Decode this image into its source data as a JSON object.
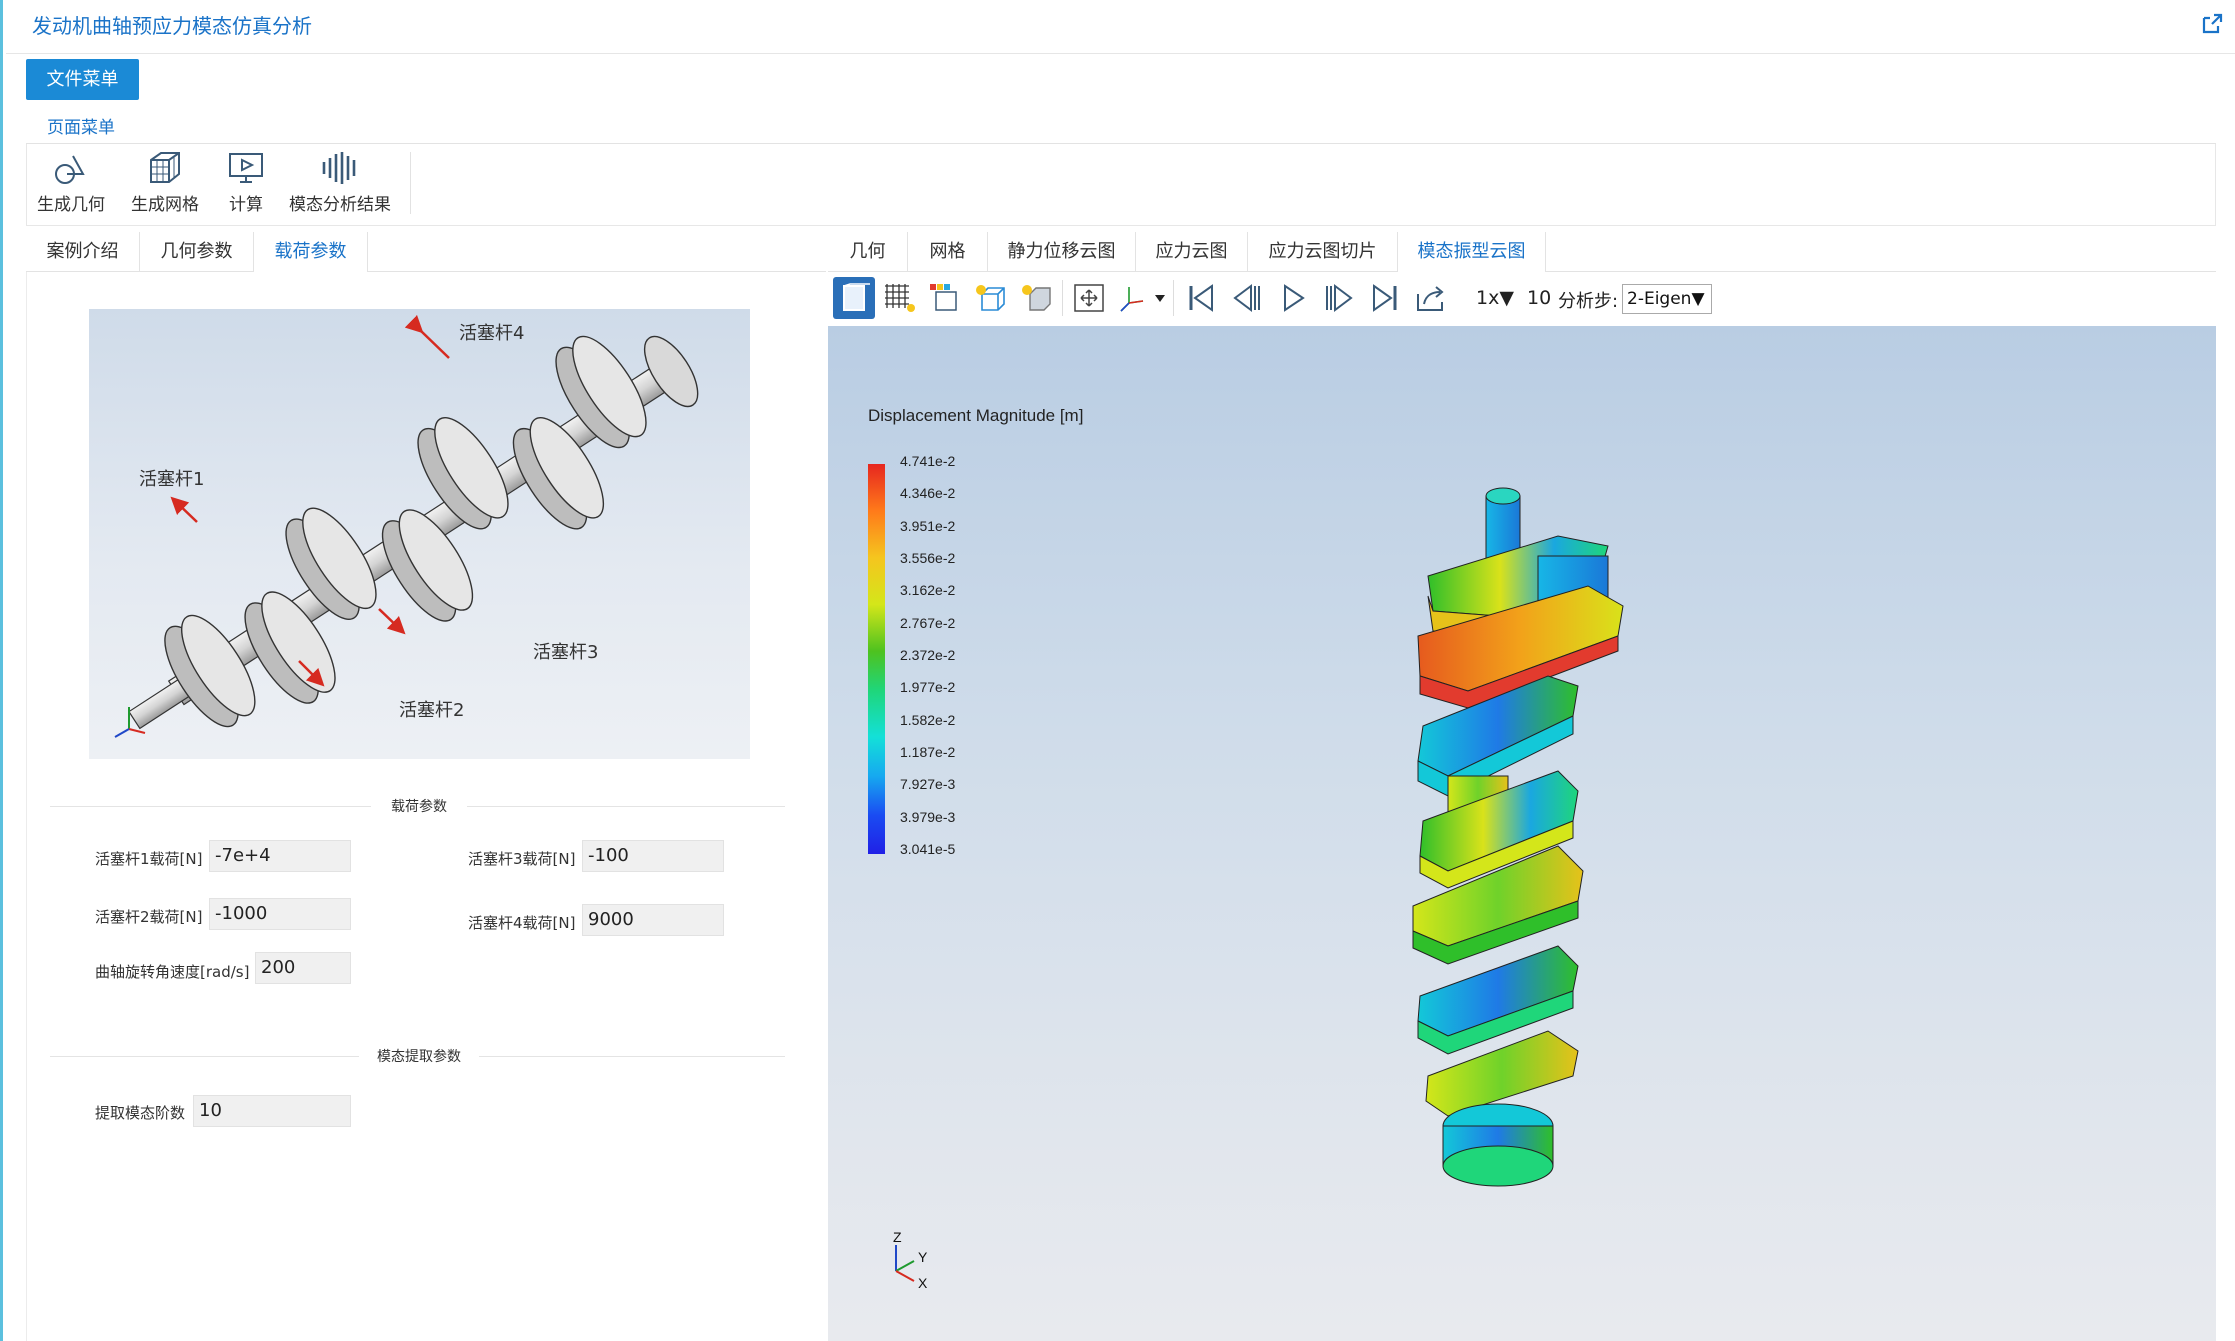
{
  "window": {
    "title": "发动机曲轴预应力模态仿真分析"
  },
  "file_menu": {
    "label": "文件菜单"
  },
  "page_menu": {
    "label": "页面菜单"
  },
  "ribbon": {
    "items": [
      {
        "label": "生成几何",
        "icon": "geometry-icon"
      },
      {
        "label": "生成网格",
        "icon": "mesh-icon"
      },
      {
        "label": "计算",
        "icon": "compute-icon"
      },
      {
        "label": "模态分析结果",
        "icon": "modal-result-icon"
      }
    ]
  },
  "left_tabs": [
    {
      "label": "案例介绍"
    },
    {
      "label": "几何参数"
    },
    {
      "label": "载荷参数",
      "active": true
    }
  ],
  "figure": {
    "labels": {
      "rod1": "活塞杆1",
      "rod2": "活塞杆2",
      "rod3": "活塞杆3",
      "rod4": "活塞杆4"
    }
  },
  "load_params": {
    "section_title": "载荷参数",
    "rod1": {
      "label": "活塞杆1载荷[N]",
      "value": "-7e+4"
    },
    "rod2": {
      "label": "活塞杆2载荷[N]",
      "value": "-1000"
    },
    "rod3": {
      "label": "活塞杆3载荷[N]",
      "value": "-100"
    },
    "rod4": {
      "label": "活塞杆4载荷[N]",
      "value": "9000"
    },
    "speed": {
      "label": "曲轴旋转角速度[rad/s]",
      "value": "200"
    }
  },
  "modal_params": {
    "section_title": "模态提取参数",
    "order": {
      "label": "提取模态阶数",
      "value": "10"
    }
  },
  "right_tabs": [
    {
      "label": "几何"
    },
    {
      "label": "网格"
    },
    {
      "label": "静力位移云图"
    },
    {
      "label": "应力云图"
    },
    {
      "label": "应力云图切片"
    },
    {
      "label": "模态振型云图",
      "active": true
    }
  ],
  "viewer_toolbar": {
    "speed": "1x▼",
    "frames": "10",
    "step_label": "分析步:",
    "step_value": "2-Eigen▼"
  },
  "legend": {
    "title": "Displacement Magnitude [m]",
    "ticks": [
      "4.741e-2",
      "4.346e-2",
      "3.951e-2",
      "3.556e-2",
      "3.162e-2",
      "2.767e-2",
      "2.372e-2",
      "1.977e-2",
      "1.582e-2",
      "1.187e-2",
      "7.927e-3",
      "3.979e-3",
      "3.041e-5"
    ]
  },
  "axes": {
    "z": "Z",
    "y": "Y",
    "x": "X"
  },
  "colors": {
    "accent": "#1a73c8",
    "button": "#1b8ad6",
    "frame": "#5bc0de"
  }
}
